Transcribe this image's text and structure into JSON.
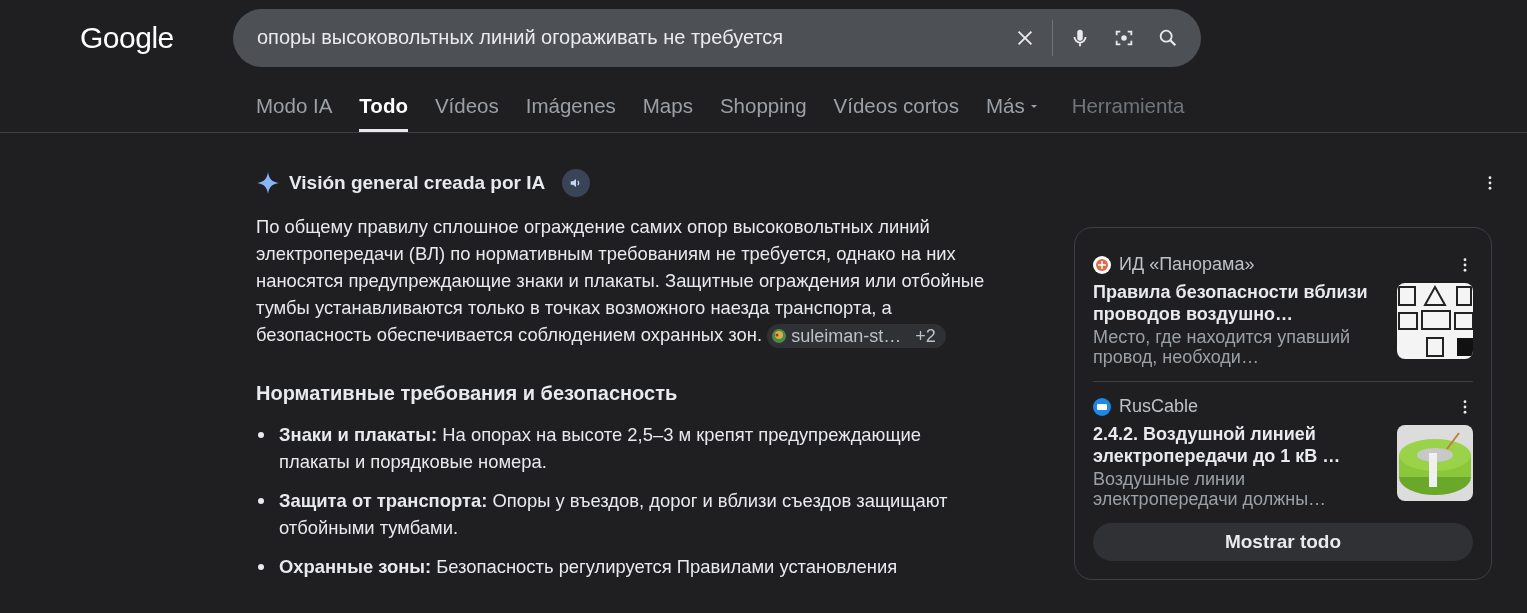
{
  "header": {
    "logo": "Google",
    "search": {
      "value": "опоры высоковольтных линий огораживать не требуется"
    }
  },
  "tabs": [
    {
      "label": "Modo IA",
      "selected": false,
      "kind": "tab"
    },
    {
      "label": "Todo",
      "selected": true,
      "kind": "tab"
    },
    {
      "label": "Vídeos",
      "selected": false,
      "kind": "tab"
    },
    {
      "label": "Imágenes",
      "selected": false,
      "kind": "tab"
    },
    {
      "label": "Maps",
      "selected": false,
      "kind": "tab"
    },
    {
      "label": "Shopping",
      "selected": false,
      "kind": "tab"
    },
    {
      "label": "Vídeos cortos",
      "selected": false,
      "kind": "tab"
    },
    {
      "label": "Más",
      "selected": false,
      "kind": "menu"
    },
    {
      "label": "Herramienta",
      "selected": false,
      "kind": "tools"
    }
  ],
  "overview": {
    "title": "Visión general creada por IA",
    "summary": "По общему правилу сплошное ограждение самих опор высоковольтных линий электропередачи (ВЛ) по нормативным требованиям не требуется, однако на них наносятся предупреждающие знаки и плакаты. Защитные ограждения или отбойные тумбы устанавливаются только в точках возможного наезда транспорта, а безопасность обеспечивается соблюдением охранных зон.",
    "source_chip": {
      "name": "suleiman-st…",
      "more": "+2"
    },
    "heading": "Нормативные требования и безопасность",
    "bullets": [
      "**Знаки и плакаты:** На опорах на высоте 2,5–3 м крепят предупреждающие плакаты и порядковые номера.",
      "**Защита от транспорта:** Опоры у въездов, дорог и вблизи съездов защищают отбойными тумбами.",
      "**Охранные зоны:** Безопасность регулируется Правилами установления"
    ]
  },
  "sources": {
    "items": [
      {
        "site": "ИД «Панорама»",
        "title": "Правила безопасности вблизи проводов воздушно…",
        "snippet": "Место, где находится упавший провод, необходи…",
        "kind": "signs"
      },
      {
        "site": "RusCable",
        "title": "2.4.2. Воздушной линией электропередачи до 1 кВ …",
        "snippet": "Воздушные линии электропередачи должны…",
        "kind": "cable"
      }
    ],
    "show_all": "Mostrar todo"
  }
}
